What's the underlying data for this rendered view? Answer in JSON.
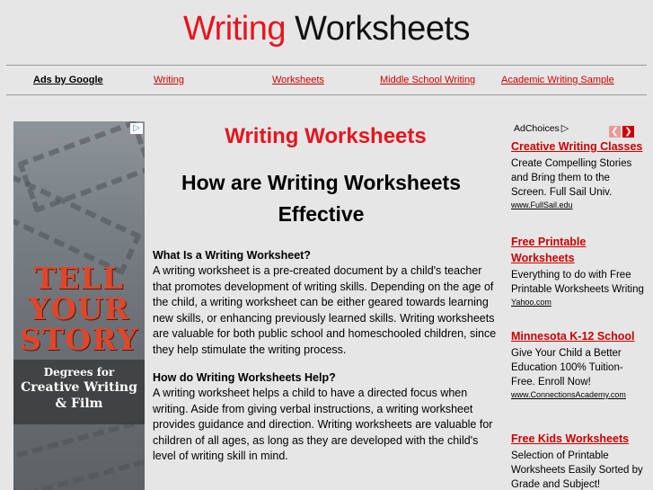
{
  "header": {
    "title_part1": "Writing",
    "title_part2": "Worksheets"
  },
  "nav": {
    "ads_label": "Ads by Google",
    "links": [
      "Writing",
      "Worksheets",
      "Middle School Writing",
      "Academic Writing Sample"
    ]
  },
  "left_ad": {
    "headline_line1": "TELL",
    "headline_line2": "YOUR",
    "headline_line3": "STORY",
    "tagline1": "Degrees for",
    "tagline2": "Creative Writing",
    "tagline3": "& Film",
    "corner_icon": "adchoices-icon"
  },
  "main": {
    "heading": "Writing Worksheets",
    "subheading": "How are Writing Worksheets Effective",
    "section1_title": "What Is a Writing Worksheet?",
    "section1_body": "A writing worksheet is a pre-created document by a child's teacher that promotes development of writing skills. Depending on the age of the child, a writing worksheet can be either geared towards learning new skills, or enhancing previously learned skills. Writing worksheets are valuable for both public school and homeschooled children, since they help stimulate the writing process.",
    "section2_title": "How do Writing Worksheets Help?",
    "section2_body": "A writing worksheet helps a child to have a directed focus when writing. Aside from giving verbal instructions, a writing worksheet provides guidance and direction. Writing worksheets are valuable for children of all ages, as long as they are developed with the child's level of writing skill in mind."
  },
  "right_ads": {
    "adchoices_label": "AdChoices",
    "items": [
      {
        "title": "Creative Writing Classes",
        "desc": "Create Compelling Stories and Bring them to the Screen. Full Sail Univ.",
        "url": "www.FullSail.edu"
      },
      {
        "title": "Free Printable Worksheets",
        "desc": "Everything to do with Free Printable Worksheets Writing",
        "url": "Yahoo.com"
      },
      {
        "title": "Minnesota K-12 School",
        "desc": "Give Your Child a Better Education 100% Tuition-Free. Enroll Now!",
        "url": "www.ConnectionsAcademy.com"
      },
      {
        "title": "Free Kids Worksheets",
        "desc": "Selection of Printable Worksheets Easily Sorted by Grade and Subject!",
        "url": ""
      }
    ]
  },
  "colors": {
    "accent_red": "#e8141c",
    "link_red": "#cc0000",
    "background": "#e6e6e6"
  }
}
